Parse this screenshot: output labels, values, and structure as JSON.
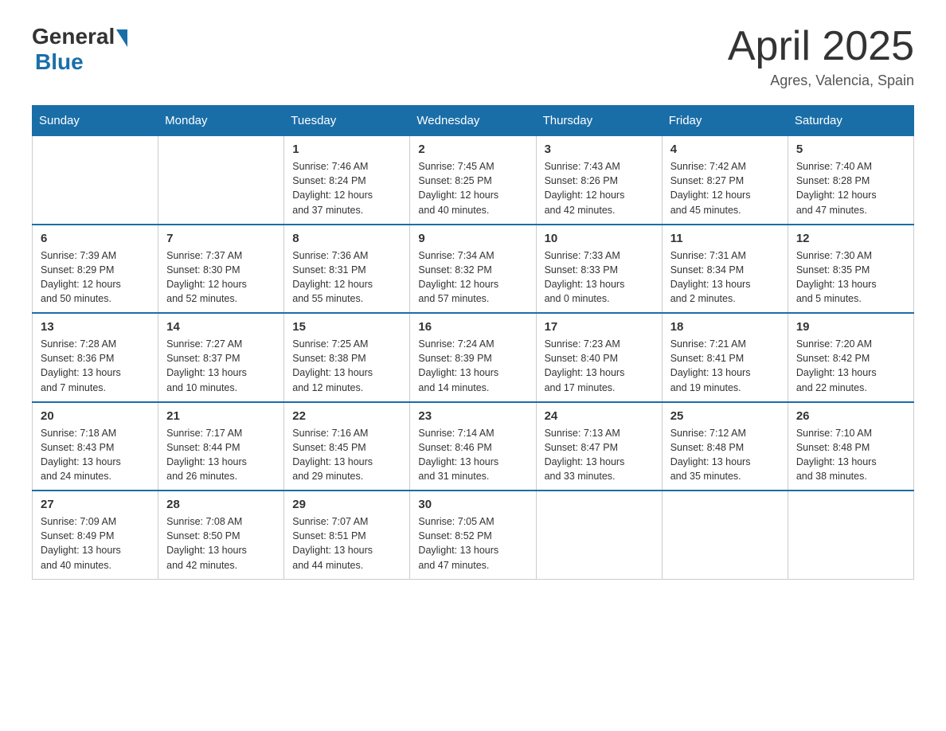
{
  "header": {
    "logo_general": "General",
    "logo_blue": "Blue",
    "month_title": "April 2025",
    "subtitle": "Agres, Valencia, Spain"
  },
  "weekdays": [
    "Sunday",
    "Monday",
    "Tuesday",
    "Wednesday",
    "Thursday",
    "Friday",
    "Saturday"
  ],
  "weeks": [
    [
      {
        "day": "",
        "info": ""
      },
      {
        "day": "",
        "info": ""
      },
      {
        "day": "1",
        "info": "Sunrise: 7:46 AM\nSunset: 8:24 PM\nDaylight: 12 hours\nand 37 minutes."
      },
      {
        "day": "2",
        "info": "Sunrise: 7:45 AM\nSunset: 8:25 PM\nDaylight: 12 hours\nand 40 minutes."
      },
      {
        "day": "3",
        "info": "Sunrise: 7:43 AM\nSunset: 8:26 PM\nDaylight: 12 hours\nand 42 minutes."
      },
      {
        "day": "4",
        "info": "Sunrise: 7:42 AM\nSunset: 8:27 PM\nDaylight: 12 hours\nand 45 minutes."
      },
      {
        "day": "5",
        "info": "Sunrise: 7:40 AM\nSunset: 8:28 PM\nDaylight: 12 hours\nand 47 minutes."
      }
    ],
    [
      {
        "day": "6",
        "info": "Sunrise: 7:39 AM\nSunset: 8:29 PM\nDaylight: 12 hours\nand 50 minutes."
      },
      {
        "day": "7",
        "info": "Sunrise: 7:37 AM\nSunset: 8:30 PM\nDaylight: 12 hours\nand 52 minutes."
      },
      {
        "day": "8",
        "info": "Sunrise: 7:36 AM\nSunset: 8:31 PM\nDaylight: 12 hours\nand 55 minutes."
      },
      {
        "day": "9",
        "info": "Sunrise: 7:34 AM\nSunset: 8:32 PM\nDaylight: 12 hours\nand 57 minutes."
      },
      {
        "day": "10",
        "info": "Sunrise: 7:33 AM\nSunset: 8:33 PM\nDaylight: 13 hours\nand 0 minutes."
      },
      {
        "day": "11",
        "info": "Sunrise: 7:31 AM\nSunset: 8:34 PM\nDaylight: 13 hours\nand 2 minutes."
      },
      {
        "day": "12",
        "info": "Sunrise: 7:30 AM\nSunset: 8:35 PM\nDaylight: 13 hours\nand 5 minutes."
      }
    ],
    [
      {
        "day": "13",
        "info": "Sunrise: 7:28 AM\nSunset: 8:36 PM\nDaylight: 13 hours\nand 7 minutes."
      },
      {
        "day": "14",
        "info": "Sunrise: 7:27 AM\nSunset: 8:37 PM\nDaylight: 13 hours\nand 10 minutes."
      },
      {
        "day": "15",
        "info": "Sunrise: 7:25 AM\nSunset: 8:38 PM\nDaylight: 13 hours\nand 12 minutes."
      },
      {
        "day": "16",
        "info": "Sunrise: 7:24 AM\nSunset: 8:39 PM\nDaylight: 13 hours\nand 14 minutes."
      },
      {
        "day": "17",
        "info": "Sunrise: 7:23 AM\nSunset: 8:40 PM\nDaylight: 13 hours\nand 17 minutes."
      },
      {
        "day": "18",
        "info": "Sunrise: 7:21 AM\nSunset: 8:41 PM\nDaylight: 13 hours\nand 19 minutes."
      },
      {
        "day": "19",
        "info": "Sunrise: 7:20 AM\nSunset: 8:42 PM\nDaylight: 13 hours\nand 22 minutes."
      }
    ],
    [
      {
        "day": "20",
        "info": "Sunrise: 7:18 AM\nSunset: 8:43 PM\nDaylight: 13 hours\nand 24 minutes."
      },
      {
        "day": "21",
        "info": "Sunrise: 7:17 AM\nSunset: 8:44 PM\nDaylight: 13 hours\nand 26 minutes."
      },
      {
        "day": "22",
        "info": "Sunrise: 7:16 AM\nSunset: 8:45 PM\nDaylight: 13 hours\nand 29 minutes."
      },
      {
        "day": "23",
        "info": "Sunrise: 7:14 AM\nSunset: 8:46 PM\nDaylight: 13 hours\nand 31 minutes."
      },
      {
        "day": "24",
        "info": "Sunrise: 7:13 AM\nSunset: 8:47 PM\nDaylight: 13 hours\nand 33 minutes."
      },
      {
        "day": "25",
        "info": "Sunrise: 7:12 AM\nSunset: 8:48 PM\nDaylight: 13 hours\nand 35 minutes."
      },
      {
        "day": "26",
        "info": "Sunrise: 7:10 AM\nSunset: 8:48 PM\nDaylight: 13 hours\nand 38 minutes."
      }
    ],
    [
      {
        "day": "27",
        "info": "Sunrise: 7:09 AM\nSunset: 8:49 PM\nDaylight: 13 hours\nand 40 minutes."
      },
      {
        "day": "28",
        "info": "Sunrise: 7:08 AM\nSunset: 8:50 PM\nDaylight: 13 hours\nand 42 minutes."
      },
      {
        "day": "29",
        "info": "Sunrise: 7:07 AM\nSunset: 8:51 PM\nDaylight: 13 hours\nand 44 minutes."
      },
      {
        "day": "30",
        "info": "Sunrise: 7:05 AM\nSunset: 8:52 PM\nDaylight: 13 hours\nand 47 minutes."
      },
      {
        "day": "",
        "info": ""
      },
      {
        "day": "",
        "info": ""
      },
      {
        "day": "",
        "info": ""
      }
    ]
  ]
}
